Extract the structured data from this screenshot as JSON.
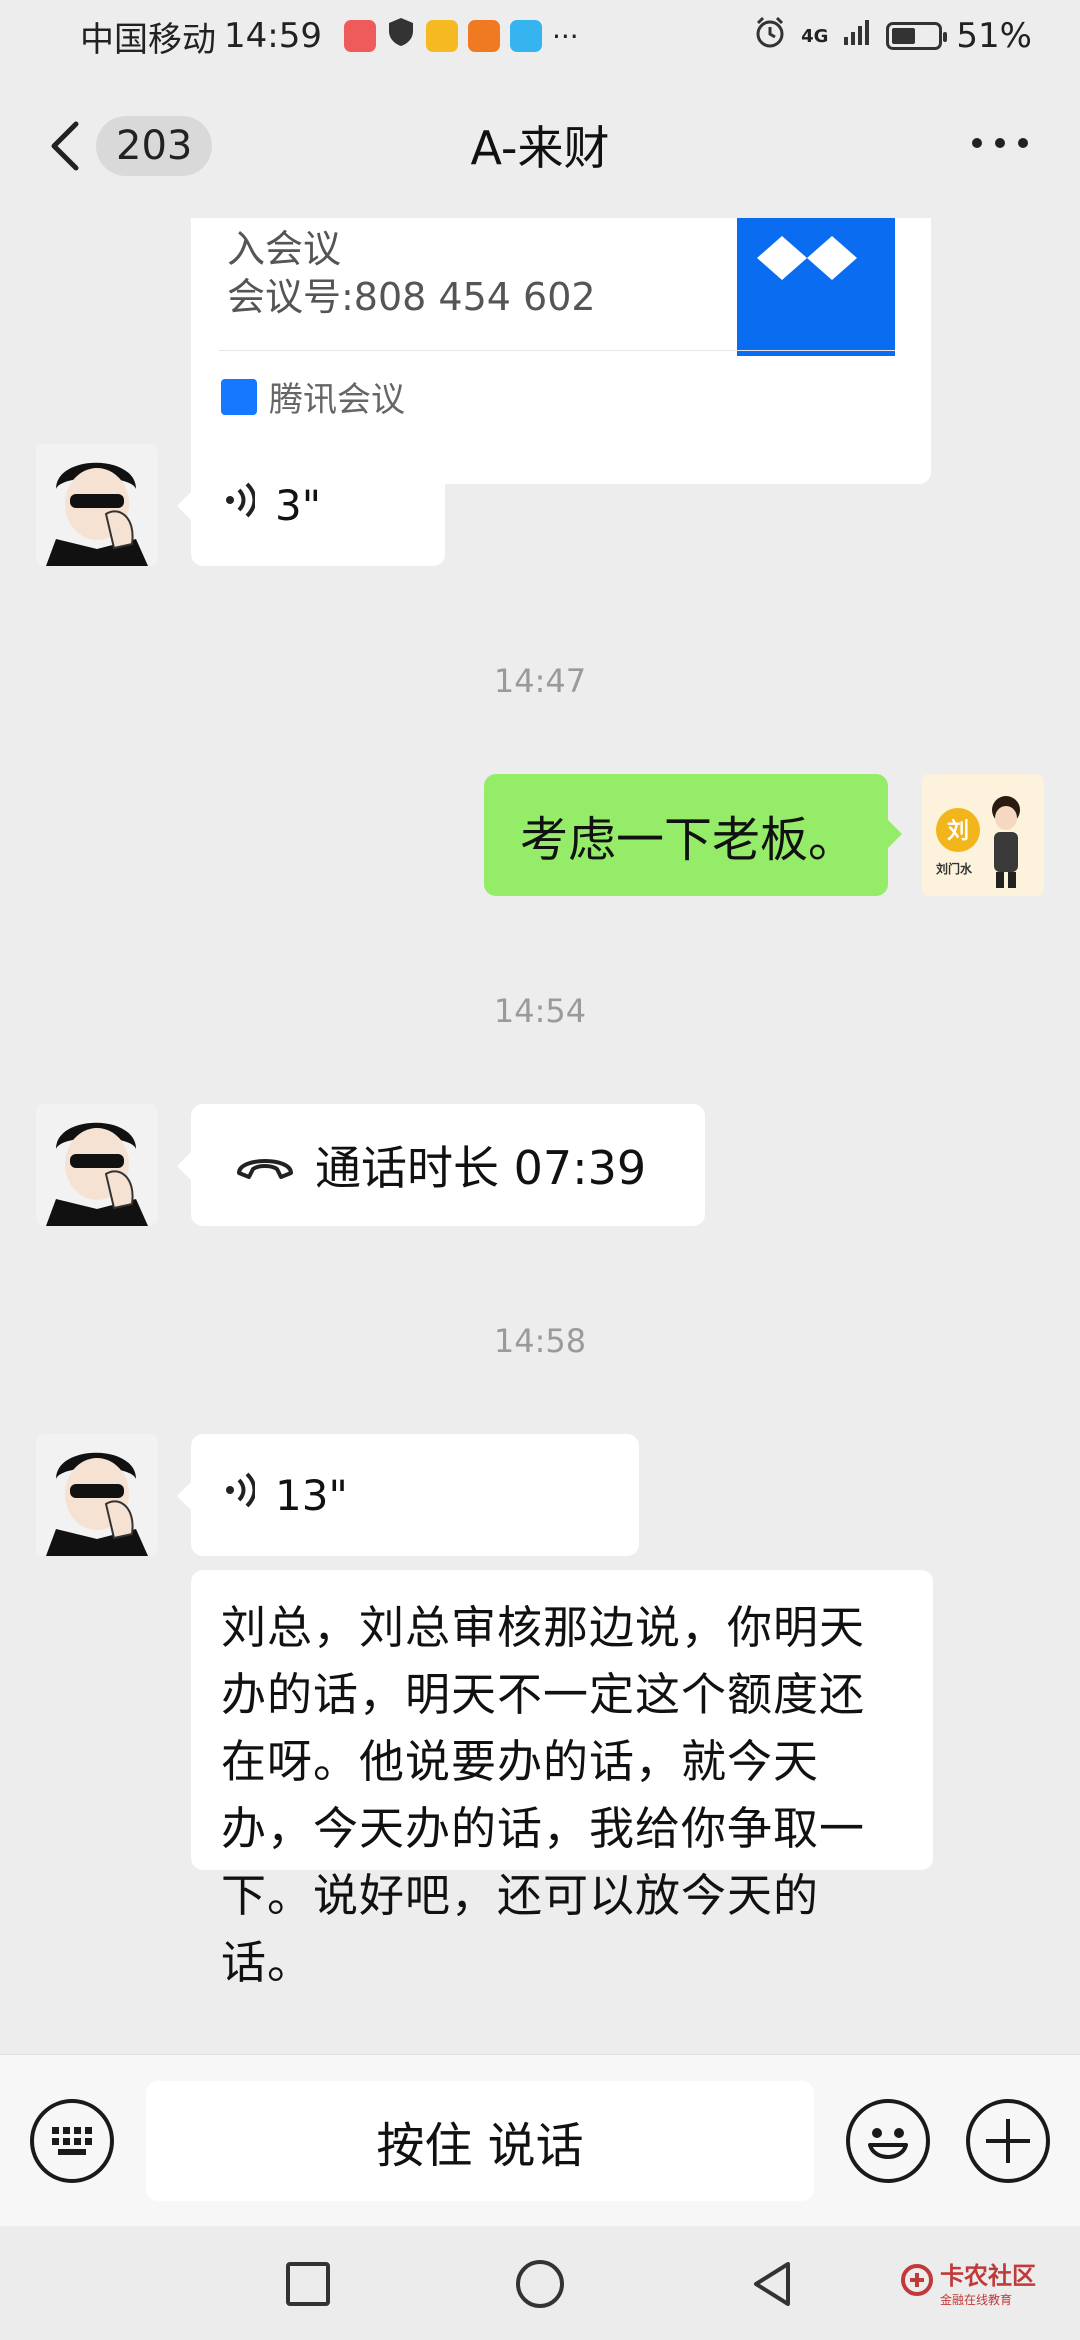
{
  "status_bar": {
    "carrier": "中国移动",
    "time": "14:59",
    "network": "4G",
    "battery_percent": "51%",
    "battery_level": 0.51
  },
  "header": {
    "unread_count": "203",
    "title": "A-来财"
  },
  "messages": {
    "meeting_card": {
      "partial_line": "入会议",
      "meeting_id": "会议号:808 454 602",
      "source": "腾讯会议"
    },
    "voice_1": {
      "duration": "3\""
    },
    "time_1": "14:47",
    "outgoing_1": {
      "text": "考虑一下老板。"
    },
    "outgoing_avatar": {
      "name_char": "刘",
      "name": "刘门水"
    },
    "time_2": "14:54",
    "call_1": {
      "text": "通话时长 07:39"
    },
    "time_3": "14:58",
    "voice_2": {
      "duration": "13\""
    },
    "text_1": {
      "text": "刘总，刘总审核那边说，你明天办的话，明天不一定这个额度还在呀。他说要办的话，就今天办，今天办的话，我给你争取一下。说好吧，还可以放今天的话。"
    }
  },
  "input_bar": {
    "hold_to_talk": "按住 说话"
  },
  "watermark": {
    "title": "卡农社区",
    "subtitle": "金融在线教育"
  },
  "icons": {
    "back": "chevron-left-icon",
    "more": "more-dots-icon",
    "voice": "voice-wave-icon",
    "call": "phone-hangup-icon",
    "keyboard": "keyboard-icon",
    "emoji": "emoji-icon",
    "plus": "plus-icon"
  },
  "colors": {
    "background": "#ededed",
    "outgoing_bubble": "#95ec69",
    "incoming_bubble": "#ffffff",
    "meeting_blue": "#0a6cf0"
  }
}
